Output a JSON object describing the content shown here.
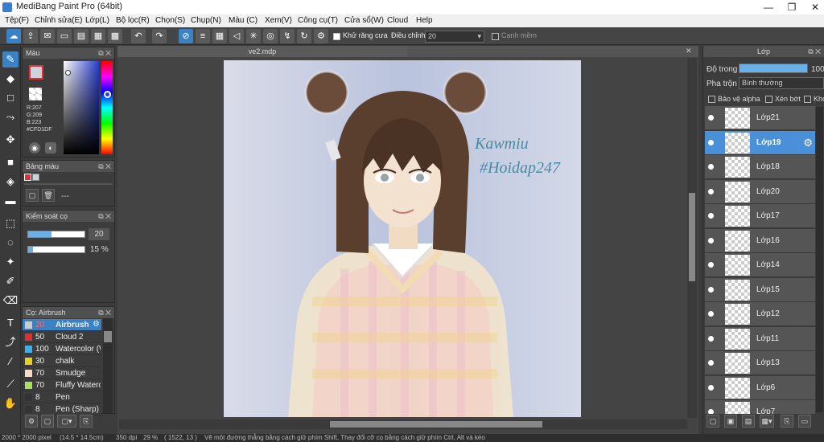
{
  "app": {
    "title": "MediBang Paint Pro (64bit)"
  },
  "window_controls": {
    "minimize": "—",
    "restore": "❐",
    "close": "✕"
  },
  "menu": [
    "Tệp(F)",
    "Chỉnh sửa(E)",
    "Lớp(L)",
    "Bộ lọc(R)",
    "Chọn(S)",
    "Chụp(N)",
    "Màu (C)",
    "Xem(V)",
    "Công cụ(T)",
    "Cửa sổ(W)",
    "Cloud",
    "Help"
  ],
  "toolbar": {
    "antialias_label": "Khử răng cưa",
    "adjust_label": "Điều chỉnh",
    "adjust_value": "20",
    "edge_label": "Cạnh mềm"
  },
  "color_panel": {
    "title": "Màu",
    "r": "R:207",
    "g": "G:209",
    "b": "B:223",
    "hex": "#CFD1DF"
  },
  "palette_panel": {
    "title": "Bảng màu",
    "placeholder": "---"
  },
  "brush_control": {
    "title": "Kiểm soát cọ",
    "size_value": "20",
    "opacity_value": "15 %",
    "size_fraction": 0.42,
    "opacity_fraction": 0.08
  },
  "brush_panel": {
    "title": "Cọ: Airbrush",
    "brushes": [
      {
        "size": "20",
        "name": "Airbrush",
        "color": "#cccccc",
        "selected": true
      },
      {
        "size": "50",
        "name": "Cloud 2",
        "color": "#e03030"
      },
      {
        "size": "100",
        "name": "Watercolor (W",
        "color": "#3ab0e8"
      },
      {
        "size": "30",
        "name": "chalk",
        "color": "#e8d020"
      },
      {
        "size": "70",
        "name": "Smudge",
        "color": "#f5dcc8"
      },
      {
        "size": "70",
        "name": "Fluffy Waterco",
        "color": "#a8e060"
      },
      {
        "size": "8",
        "name": "Pen",
        "color": "#333333"
      },
      {
        "size": "8",
        "name": "Pen (Sharp)",
        "color": "#333333"
      }
    ]
  },
  "document": {
    "tab_name": "ve2.mdp",
    "signature": "Kawmiu #Hoidap247"
  },
  "layer_panel": {
    "title": "Lớp",
    "opacity_label": "Độ trong",
    "opacity_value": "100",
    "opacity_fraction": 1.0,
    "blend_label": "Pha trộn",
    "blend_value": "Bình thường",
    "protect_alpha": "Bảo vệ alpha",
    "clipping": "Xén bớt",
    "lock": "Khó",
    "layers": [
      "Lớp21",
      "Lớp19",
      "Lớp18",
      "Lớp20",
      "Lớp17",
      "Lớp16",
      "Lớp14",
      "Lớp15",
      "Lớp12",
      "Lớp11",
      "Lớp13",
      "Lớp6",
      "Lớp7"
    ],
    "selected_layer": "Lớp19"
  },
  "status": {
    "dimensions": "2000 * 2000 pixel",
    "physical": "(14.5 * 14.5cm)",
    "dpi": "350 dpi",
    "zoom": "29 %",
    "coords": "( 1522, 13 )",
    "hint": "Vẽ một đường thẳng bằng cách giữ phím Shift, Thay đổi cỡ cọ bằng cách giữ phím Ctrl, Alt và kéo"
  }
}
